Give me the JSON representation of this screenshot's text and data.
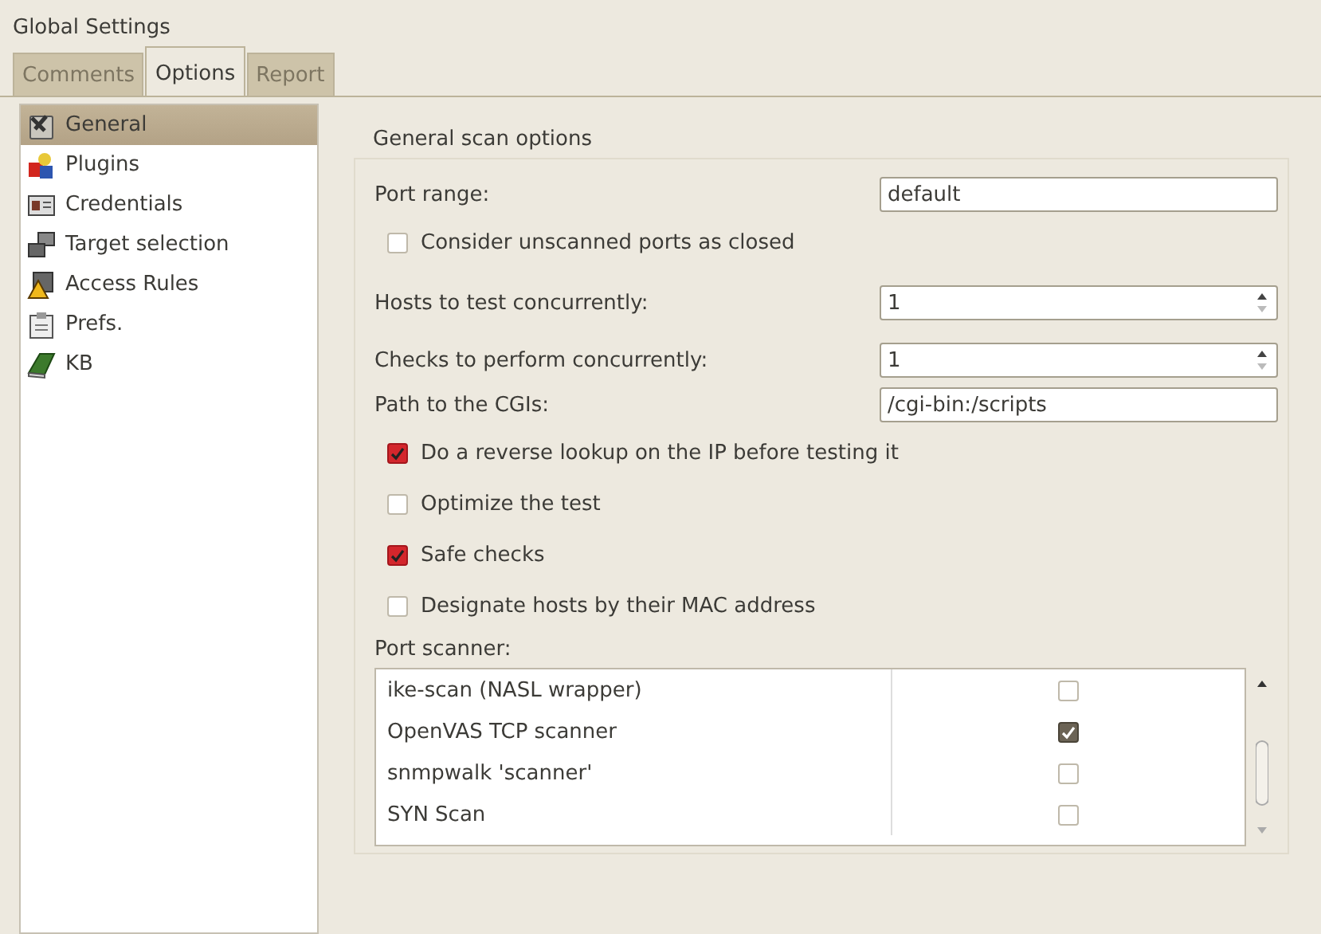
{
  "window": {
    "title": "Global Settings"
  },
  "tabs": [
    {
      "label": "Comments",
      "selected": false,
      "disabled": true
    },
    {
      "label": "Options",
      "selected": true,
      "disabled": false
    },
    {
      "label": "Report",
      "selected": false,
      "disabled": true
    }
  ],
  "sidebar": {
    "items": [
      {
        "label": "General",
        "selected": true,
        "kind": "tools"
      },
      {
        "label": "Plugins",
        "selected": false,
        "kind": "plugins"
      },
      {
        "label": "Credentials",
        "selected": false,
        "kind": "card"
      },
      {
        "label": "Target selection",
        "selected": false,
        "kind": "computers"
      },
      {
        "label": "Access Rules",
        "selected": false,
        "kind": "warning"
      },
      {
        "label": "Prefs.",
        "selected": false,
        "kind": "clipboard"
      },
      {
        "label": "KB",
        "selected": false,
        "kind": "book"
      }
    ]
  },
  "section": {
    "title": "General scan options",
    "rows": [
      {
        "kind": "text",
        "label": "Port range:",
        "value": "default"
      },
      {
        "kind": "check",
        "label": "Consider unscanned ports as closed",
        "checked": false
      },
      {
        "kind": "spin",
        "label": "Hosts to test concurrently:",
        "value": "1"
      },
      {
        "kind": "spin",
        "label": "Checks to perform concurrently:",
        "value": "1"
      },
      {
        "kind": "text",
        "label": "Path to the CGIs:",
        "value": "/cgi-bin:/scripts"
      },
      {
        "kind": "check",
        "label": "Do a reverse lookup on the IP before testing it",
        "checked": true
      },
      {
        "kind": "check",
        "label": "Optimize the test",
        "checked": false
      },
      {
        "kind": "check",
        "label": "Safe checks",
        "checked": true
      },
      {
        "kind": "check",
        "label": "Designate hosts by their MAC address",
        "checked": false
      }
    ],
    "port_scanner": {
      "label": "Port scanner:",
      "rows": [
        {
          "name": "ike-scan (NASL wrapper)",
          "checked": false
        },
        {
          "name": "OpenVAS TCP scanner",
          "checked": true
        },
        {
          "name": "snmpwalk 'scanner'",
          "checked": false
        },
        {
          "name": "SYN Scan",
          "checked": false
        }
      ]
    }
  }
}
